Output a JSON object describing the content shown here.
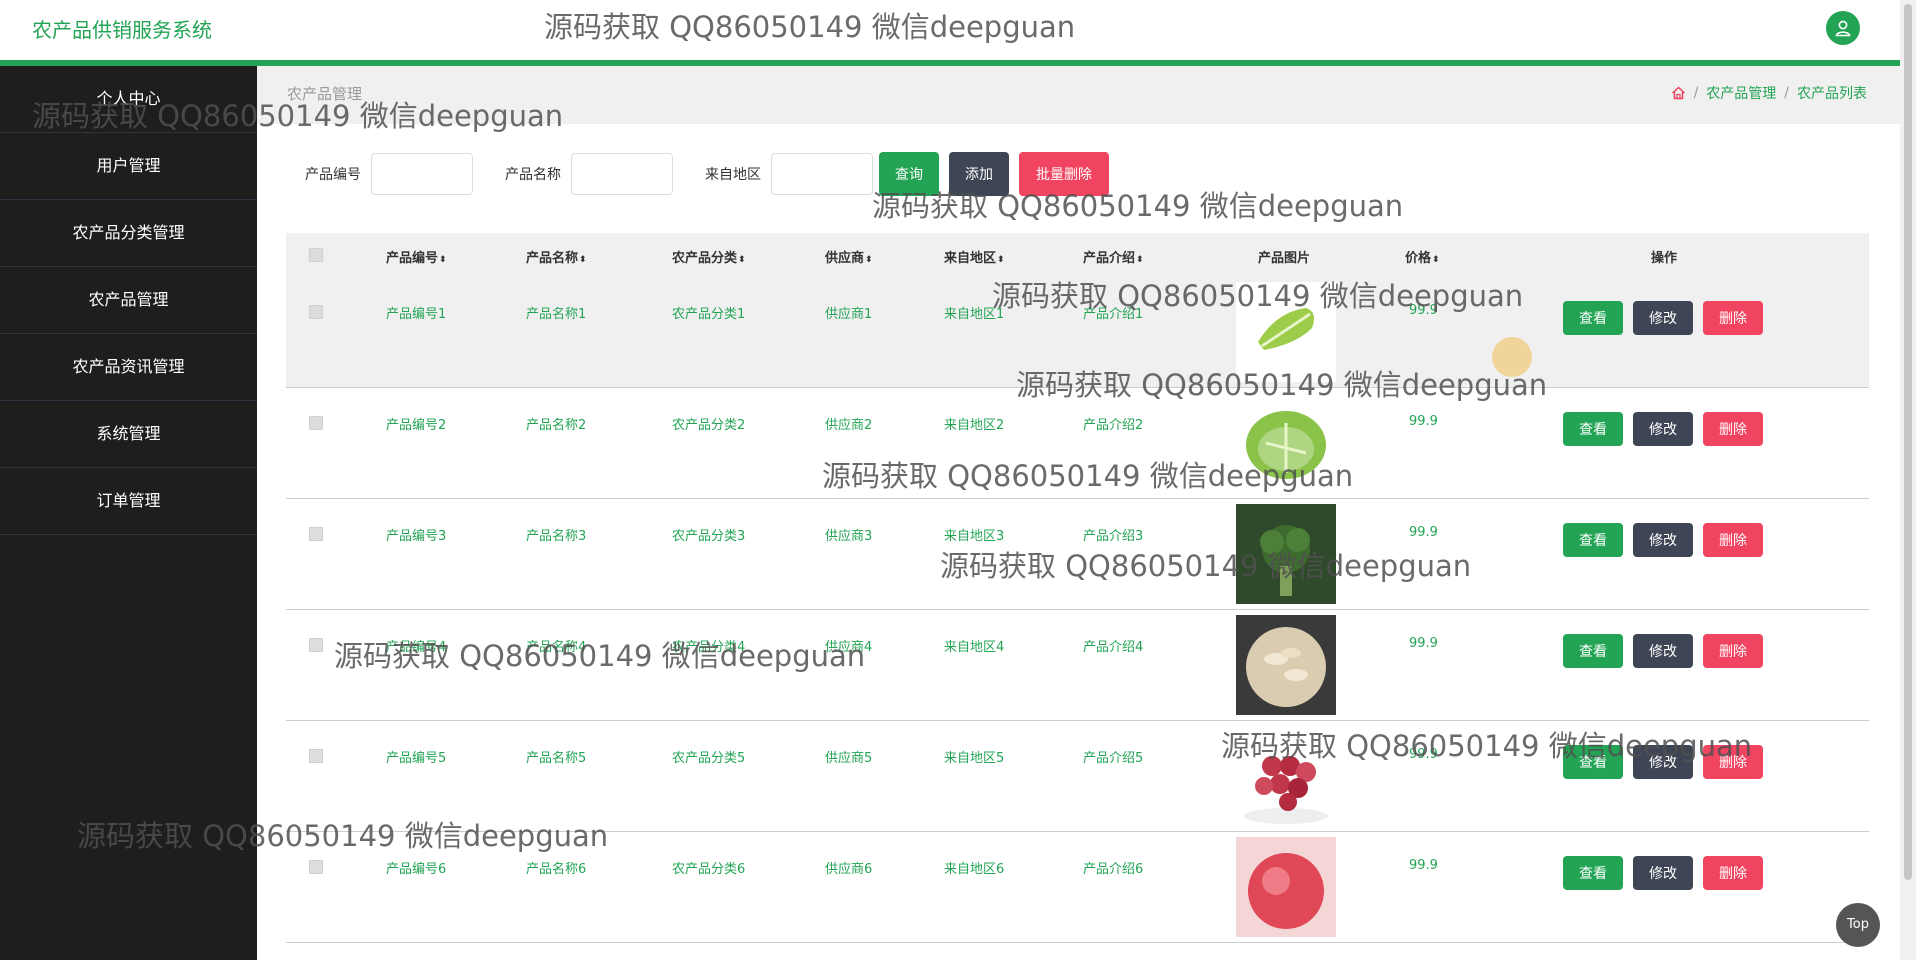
{
  "header": {
    "title": "农产品供销服务系统",
    "user_icon": "user-icon"
  },
  "sidebar": {
    "items": [
      {
        "label": "个人中心"
      },
      {
        "label": "用户管理"
      },
      {
        "label": "农产品分类管理"
      },
      {
        "label": "农产品管理"
      },
      {
        "label": "农产品资讯管理"
      },
      {
        "label": "系统管理"
      },
      {
        "label": "订单管理"
      }
    ]
  },
  "page": {
    "title": "农产品管理"
  },
  "breadcrumb": {
    "icon": "home-icon",
    "items": [
      "农产品管理",
      "农产品列表"
    ]
  },
  "search": {
    "code_label": "产品编号",
    "code_value": "",
    "name_label": "产品名称",
    "name_value": "",
    "region_label": "来自地区",
    "region_value": "",
    "query_label": "查询",
    "add_label": "添加",
    "batch_delete_label": "批量删除"
  },
  "table": {
    "headers": [
      "产品编号",
      "产品名称",
      "农产品分类",
      "供应商",
      "来自地区",
      "产品介绍",
      "产品图片",
      "价格",
      "操作"
    ],
    "rows": [
      {
        "code": "产品编号1",
        "name": "产品名称1",
        "category": "农产品分类1",
        "supplier": "供应商1",
        "region": "来自地区1",
        "intro": "产品介绍1",
        "image": "lettuce-image",
        "price": "99.9"
      },
      {
        "code": "产品编号2",
        "name": "产品名称2",
        "category": "农产品分类2",
        "supplier": "供应商2",
        "region": "来自地区2",
        "intro": "产品介绍2",
        "image": "cabbage-image",
        "price": "99.9"
      },
      {
        "code": "产品编号3",
        "name": "产品名称3",
        "category": "农产品分类3",
        "supplier": "供应商3",
        "region": "来自地区3",
        "intro": "产品介绍3",
        "image": "broccoli-image",
        "price": "99.9"
      },
      {
        "code": "产品编号4",
        "name": "产品名称4",
        "category": "农产品分类4",
        "supplier": "供应商4",
        "region": "来自地区4",
        "intro": "产品介绍4",
        "image": "nuts-image",
        "price": "99.9"
      },
      {
        "code": "产品编号5",
        "name": "产品名称5",
        "category": "农产品分类5",
        "supplier": "供应商5",
        "region": "来自地区5",
        "intro": "产品介绍5",
        "image": "grapes-image",
        "price": "99.9"
      },
      {
        "code": "产品编号6",
        "name": "产品名称6",
        "category": "农产品分类6",
        "supplier": "供应商6",
        "region": "来自地区6",
        "intro": "产品介绍6",
        "image": "apple-image",
        "price": "99.9"
      }
    ],
    "actions": {
      "view": "查看",
      "edit": "修改",
      "delete": "删除"
    }
  },
  "top_button": "Top",
  "watermark": "源码获取 QQ86050149 微信deepguan",
  "colors": {
    "accent": "#23a455",
    "sidebar_bg": "#1e1e1e",
    "danger": "#f04460",
    "dark_button": "#3e4555"
  }
}
